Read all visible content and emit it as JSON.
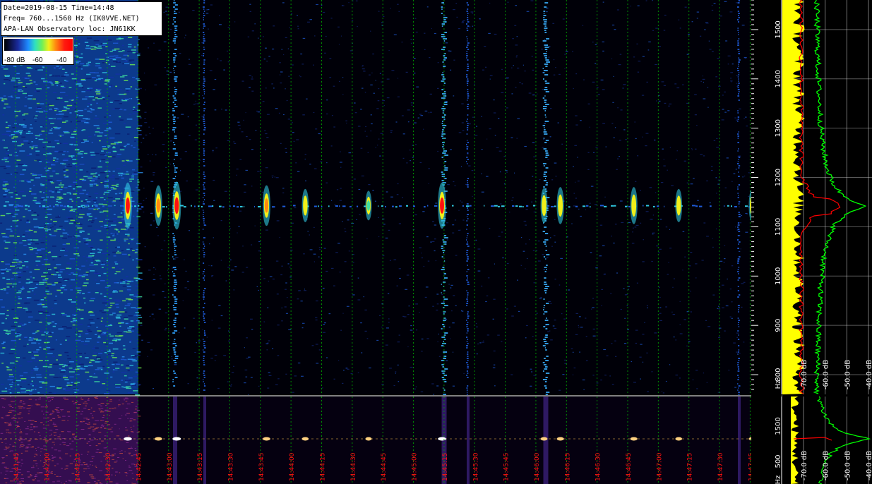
{
  "info": {
    "line1": "Date=2019-08-15 Time=14:48",
    "line2": "Freq= 760...1560 Hz (IK0VVE.NET)",
    "line3": "APA-LAN Observatory loc: JN61KK"
  },
  "legend": {
    "labels": [
      "-80 dB",
      "-60",
      "-40"
    ]
  },
  "chart_data": [
    {
      "type": "heatmap",
      "title": "",
      "y_unit": "Hz",
      "y_range": [
        760,
        1560
      ],
      "y_ticks": [
        800,
        900,
        1000,
        1100,
        1200,
        1300,
        1400,
        1500
      ],
      "carrier_hz": 1143,
      "scale_db": [
        -80,
        -60,
        -40
      ],
      "events": [
        {
          "time": "14:42:40",
          "intensity": 0.95
        },
        {
          "time": "14:42:55",
          "intensity": 0.8
        },
        {
          "time": "14:43:04",
          "intensity": 1.0
        },
        {
          "time": "14:43:48",
          "intensity": 0.8
        },
        {
          "time": "14:44:07",
          "intensity": 0.6
        },
        {
          "time": "14:44:38",
          "intensity": 0.5
        },
        {
          "time": "14:45:14",
          "intensity": 0.95
        },
        {
          "time": "14:46:04",
          "intensity": 0.65
        },
        {
          "time": "14:46:12",
          "intensity": 0.7
        },
        {
          "time": "14:46:48",
          "intensity": 0.7
        },
        {
          "time": "14:47:10",
          "intensity": 0.6
        },
        {
          "time": "14:47:46",
          "intensity": 0.6
        }
      ]
    },
    {
      "type": "heatmap",
      "title": "",
      "y_ticks": [
        500,
        1500
      ],
      "y_unit": "Hz",
      "x_ticks": [
        "14:41:45",
        "14:42:00",
        "14:42:15",
        "14:42:30",
        "14:42:45",
        "14:43:00",
        "14:43:15",
        "14:43:30",
        "14:43:45",
        "14:44:00",
        "14:44:15",
        "14:44:30",
        "14:44:45",
        "14:45:00",
        "14:45:15",
        "14:45:30",
        "14:45:45",
        "14:46:00",
        "14:46:15",
        "14:46:30",
        "14:46:45",
        "14:47:00",
        "14:47:15",
        "14:47:30",
        "14:47:45"
      ]
    },
    {
      "type": "line",
      "title": "",
      "x_ticks": [
        "-70.0 dB",
        "-60.0 dB",
        "-50.0 dB",
        "-40.0 dB"
      ],
      "series_colors": [
        "#ffff00",
        "#ff0000",
        "#00ff00"
      ],
      "peak_hz": 1143
    },
    {
      "type": "line",
      "title": "",
      "x_ticks": [
        "-70.0 dB",
        "-60.0 dB",
        "-50.0 dB",
        "-40.0 dB"
      ],
      "series_colors": [
        "#ffff00",
        "#ff0000",
        "#00ff00"
      ]
    }
  ],
  "colors": {
    "background": "#000000",
    "grid": "#00b000",
    "time_label": "#ff1010",
    "axis_text": "#ffffff"
  }
}
